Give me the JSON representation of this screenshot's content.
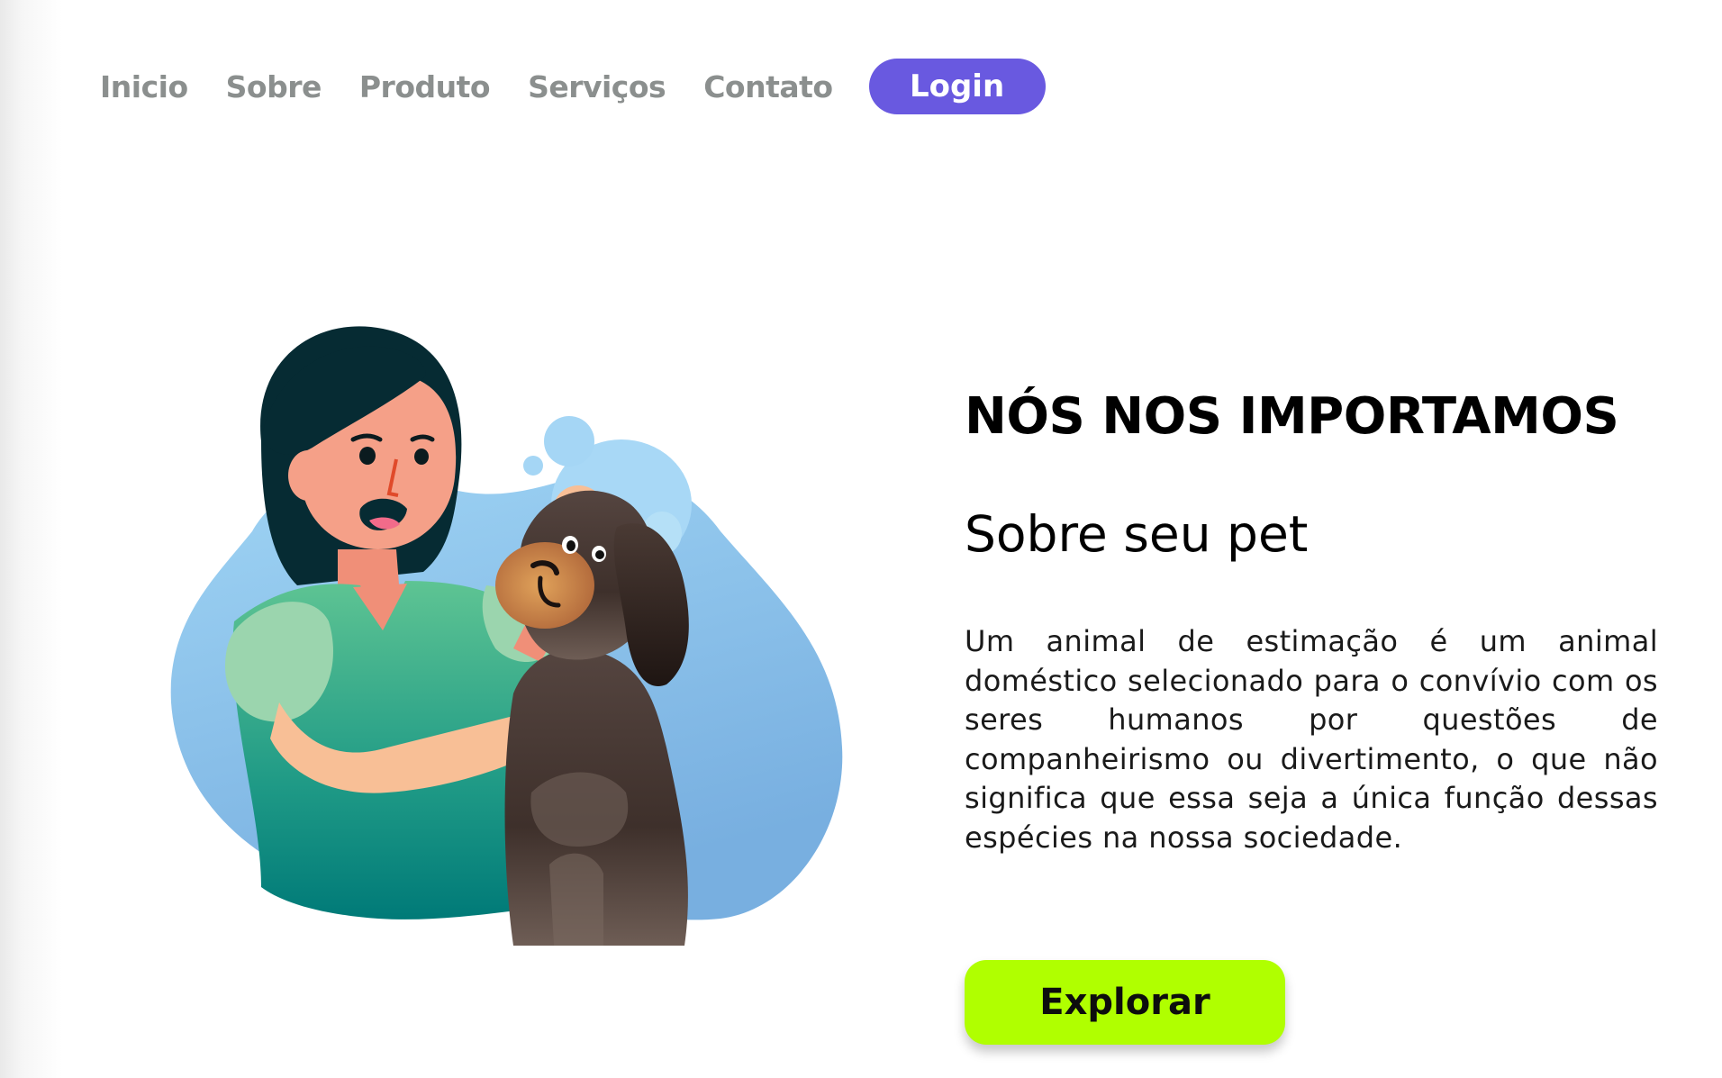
{
  "nav": {
    "items": [
      {
        "label": "Inicio"
      },
      {
        "label": "Sobre"
      },
      {
        "label": "Produto"
      },
      {
        "label": "Serviços"
      },
      {
        "label": "Contato"
      }
    ],
    "login_label": "Login"
  },
  "hero": {
    "title": "NÓS NOS IMPORTAMOS",
    "subtitle": "Sobre seu pet",
    "description": "Um animal de estimação é um animal doméstico selecionado para o convívio com os seres humanos por questões de companheirismo ou divertimento, o que não significa que essa seja a única função dessas espécies na nossa sociedade.",
    "explore_label": "Explorar"
  },
  "illustration": {
    "icon": "woman-giving-eye-drops-to-dog-illustration"
  },
  "colors": {
    "login_bg": "#6959e0",
    "explore_bg": "#b0ff00",
    "nav_text": "#8b8f8e",
    "blob_blue": "#8cc4ec",
    "shirt_green": "#3aa884",
    "hair": "#062b33",
    "dog_brown": "#4a3a33"
  }
}
